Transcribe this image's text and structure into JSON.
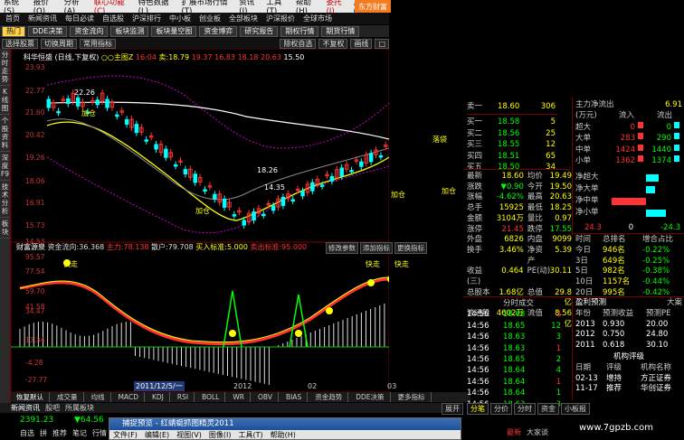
{
  "menubar": {
    "items": [
      "系统(S)",
      "报价(Q)",
      "分析(A)",
      "联心功能(C)",
      "特色数据(L)",
      "扩展市场行情(T)",
      "资讯(I)",
      "工具(T)",
      "帮助(H)",
      "委托(J)",
      "反馈(F)",
      "↓"
    ],
    "brand": "东方财富"
  },
  "navrow": {
    "items": [
      "首页",
      "新闻资讯",
      "每日必读",
      "自选股",
      "沪深排行",
      "中小板",
      "创业板",
      "全部板块",
      "沪深报价",
      "全球市场"
    ]
  },
  "tabrow": {
    "items": [
      "热门",
      "DDE决策",
      "资金流向",
      "板块监测",
      "板块量空图",
      "资金博弈",
      "研究报告",
      "期权行情",
      "期货行情"
    ]
  },
  "toolrow": {
    "left": [
      "选择股票",
      "切换周期",
      "常用指标"
    ],
    "right": [
      "除权自选",
      "不复权",
      "画线",
      "□"
    ]
  },
  "leftbar": {
    "items": [
      "分时走势",
      "K线图",
      "个股资料",
      "深度F9",
      "技术分析",
      "板块"
    ]
  },
  "stock": {
    "name": "科华恒盛",
    "period": "(日线,下复权)",
    "ma_label": "○○主图Z",
    "price1": "16:04",
    "sell_label": "卖:18.79",
    "v2": "19.37",
    "v3": "16.83",
    "v4": "18.18",
    "v5": "20.63",
    "v6": "15.50"
  },
  "yaxis_top": [
    "23.93",
    "22.77",
    "21.60",
    "20.42",
    "19.26",
    "18.06",
    "16.91",
    "15.73",
    "14.53"
  ],
  "yaxis_bottom": [
    "95.57",
    "77.54",
    "59.70",
    "41.58",
    "34.47",
    "13.34",
    "-4.28",
    "-27.77"
  ],
  "annot": {
    "hi": "22.26",
    "v1826": "18.26",
    "v1435": "14.35",
    "v1535": "15.35",
    "jiacang1": "加仓",
    "jiacang2": "加仓",
    "jiacang3": "加仓",
    "jiacang4": "加仓",
    "luo": "落袋",
    "kuaizou1": "快走",
    "kuaizou2": "快走",
    "kuaizou3": "快走",
    "date": "2011/12/5/一",
    "year": "2012",
    "m02": "02",
    "m03": "03"
  },
  "indicator": {
    "name": "财富源泉",
    "label1": "资金流向:",
    "v1": "36.368",
    "label2": "主力:",
    "v2": "78.138",
    "label3": "散户:",
    "v3": "79.708",
    "label4": "买入标准:",
    "v4": "5.000",
    "label5": "卖出标准:",
    "v5": "95.000",
    "btns": [
      "修改参数",
      "添加指标",
      "更换指标"
    ]
  },
  "bottomtabs": [
    "恢复默认",
    "成交量",
    "均线",
    "MACD",
    "KDJ",
    "RSI",
    "BOLL",
    "WR",
    "OBV",
    "BIAS",
    "资金趋势",
    "DDE决策",
    "更多指标"
  ],
  "newsrow": [
    "新闻资讯",
    "股吧",
    "所属板块"
  ],
  "status": {
    "index": "2391.23",
    "change": "▼64.56",
    "icons": [
      "自选",
      "拼",
      "推荐",
      "笔记",
      "行情"
    ]
  },
  "popup": {
    "title": "捕捉预览 - 红蜻蜓抓图精灵2011",
    "menu": [
      "文件(F)",
      "编辑(E)",
      "视图(V)",
      "图像(I)",
      "工具(T)",
      "帮助(H)"
    ]
  },
  "orderbook": {
    "sell": [
      {
        "l": "卖一",
        "p": "18.60",
        "v": "306"
      }
    ],
    "buy": [
      {
        "l": "买一",
        "p": "18.58",
        "v": "5"
      },
      {
        "l": "买二",
        "p": "18.56",
        "v": "25"
      },
      {
        "l": "买三",
        "p": "18.55",
        "v": "12"
      },
      {
        "l": "买四",
        "p": "18.51",
        "v": "65"
      },
      {
        "l": "买五",
        "p": "18.50",
        "v": "34"
      }
    ]
  },
  "flow": {
    "title": "主力净流出",
    "val": "6.91",
    "unit": "(万元)",
    "in": "流入",
    "out": "流出",
    "rows": [
      {
        "l": "超大",
        "in": "0",
        "out": "0"
      },
      {
        "l": "大单",
        "in": "283",
        "out": "290"
      },
      {
        "l": "中单",
        "in": "1424",
        "out": "1440"
      },
      {
        "l": "小单",
        "in": "1362",
        "out": "1374"
      }
    ]
  },
  "quote": [
    {
      "l": "最新",
      "v": "18.60",
      "l2": "均价",
      "v2": "19.49"
    },
    {
      "l": "涨跌",
      "v": "▼0.90",
      "l2": "今开",
      "v2": "19.50"
    },
    {
      "l": "涨幅",
      "v": "-4.62%",
      "l2": "最高",
      "v2": "20.63"
    },
    {
      "l": "总手",
      "v": "15925",
      "l2": "最低",
      "v2": "18.25"
    },
    {
      "l": "金额",
      "v": "3104万",
      "l2": "量比",
      "v2": "0.97"
    },
    {
      "l": "涨停",
      "v": "21.45",
      "l2": "跌停",
      "v2": "17.55"
    },
    {
      "l": "外盘",
      "v": "6826",
      "l2": "内盘",
      "v2": "9099"
    },
    {
      "l": "换手",
      "v": "3.46%",
      "l2": "净资产",
      "v2": "5.39"
    },
    {
      "l": "收益(三)",
      "v": "0.464",
      "l2": "PE(动)",
      "v2": "30.11"
    },
    {
      "l": "总股本",
      "v": "1.68亿",
      "l2": "总值",
      "v2": "29.8亿"
    },
    {
      "l": "流通股",
      "v": "4602万",
      "l2": "流值",
      "v2": "8.56亿"
    }
  ],
  "netflow": {
    "rows": [
      "净超大",
      "净大单",
      "净中单",
      "净小单"
    ],
    "scale_l": "24.3",
    "scale_c": "0",
    "scale_r": "-24.3"
  },
  "ranking": {
    "h1": "时间",
    "h2": "总排名",
    "h3": "增合占比",
    "rows": [
      {
        "t": "今日",
        "r": "946名",
        "p": "-0.22%"
      },
      {
        "t": "3日",
        "r": "649名",
        "p": "-0.25%"
      },
      {
        "t": "5日",
        "r": "982名",
        "p": "-0.38%"
      },
      {
        "t": "10日",
        "r": "1157名",
        "p": "-0.44%"
      },
      {
        "t": "20日",
        "r": "995名",
        "p": "-0.42%"
      }
    ]
  },
  "ticks": {
    "title": "分时成交",
    "rows": [
      {
        "t": "14:56",
        "p": "18.68",
        "v": "3"
      },
      {
        "t": "14:56",
        "p": "18.65",
        "v": "12"
      },
      {
        "t": "14:56",
        "p": "18.63",
        "v": "3"
      },
      {
        "t": "14:56",
        "p": "18.63",
        "v": "1"
      },
      {
        "t": "14:56",
        "p": "18.65",
        "v": "2"
      },
      {
        "t": "14:56",
        "p": "18.64",
        "v": "4"
      },
      {
        "t": "14:56",
        "p": "18.64",
        "v": "1"
      },
      {
        "t": "14:56",
        "p": "18.64",
        "v": "1"
      },
      {
        "t": "14:56",
        "p": "18.63",
        "v": "3"
      }
    ]
  },
  "forecast": {
    "title": "盈利预测",
    "tab": "大案",
    "h1": "年份",
    "h2": "预测收益",
    "h3": "预测PE",
    "rows": [
      {
        "y": "2013",
        "e": "0.930",
        "pe": "20.00"
      },
      {
        "y": "2012",
        "e": "0.750",
        "pe": "24.80"
      },
      {
        "y": "2011",
        "e": "0.618",
        "pe": "30.10"
      }
    ]
  },
  "rating": {
    "title": "机构评级",
    "h1": "日期",
    "h2": "评级",
    "h3": "机构名称",
    "rows": [
      {
        "d": "02-13",
        "r": "增持",
        "n": "方正证券"
      },
      {
        "d": "11-17",
        "r": "推荐",
        "n": "华创证券"
      }
    ]
  },
  "rtabs": [
    "分笔",
    "分价",
    "分时",
    "资金",
    "小板报"
  ],
  "rfoot": [
    "最新",
    "大家谈"
  ],
  "expand": "展开",
  "watermark": "www.7gpzb.com"
}
